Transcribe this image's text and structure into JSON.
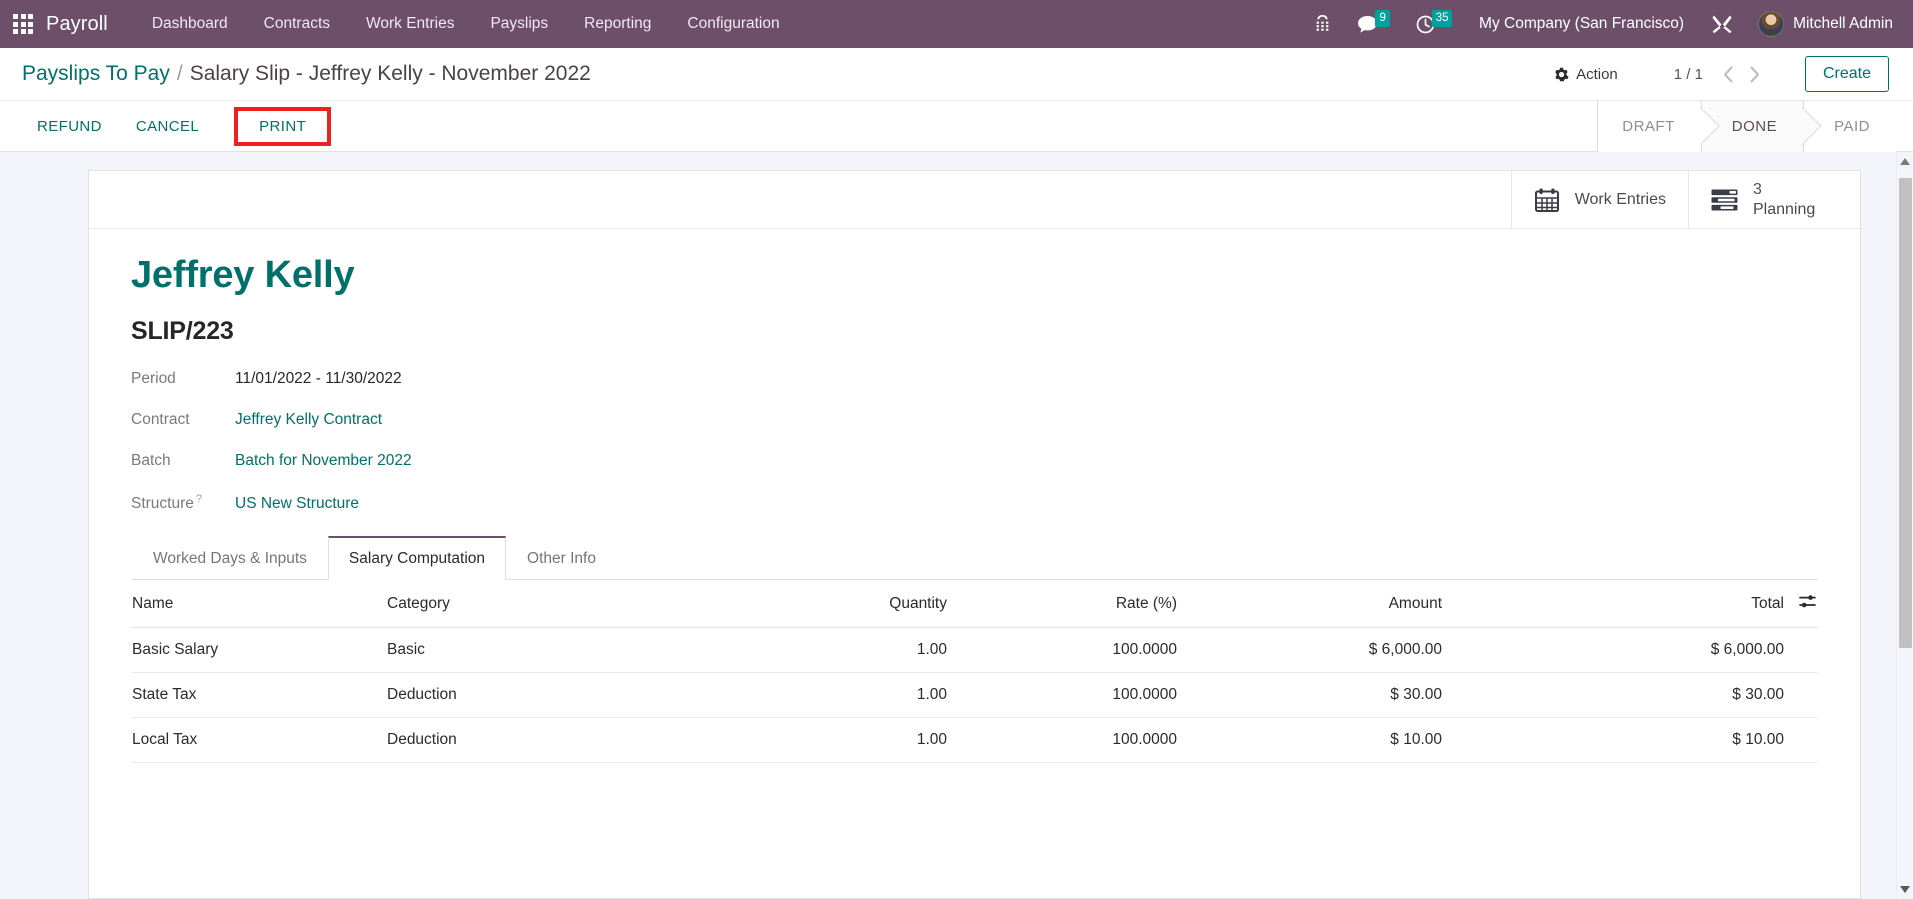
{
  "navbar": {
    "apps_icon": "apps-grid-icon",
    "brand": "Payroll",
    "menu_items": [
      {
        "label": "Dashboard"
      },
      {
        "label": "Contracts"
      },
      {
        "label": "Work Entries"
      },
      {
        "label": "Payslips"
      },
      {
        "label": "Reporting"
      },
      {
        "label": "Configuration"
      }
    ],
    "voip_icon": "phone-keypad-icon",
    "messages_icon": "chat-bubble-icon",
    "messages_count": "9",
    "activities_icon": "clock-icon",
    "activities_count": "35",
    "company": "My Company (San Francisco)",
    "tools_icon": "wrench-screwdriver-icon",
    "user_avatar": "user-avatar",
    "user_name": "Mitchell Admin",
    "badge_color": "#00a09d",
    "background_color": "#6d4f69"
  },
  "control_panel": {
    "breadcrumb": {
      "root": "Payslips To Pay",
      "separator": "/",
      "current": "Salary Slip - Jeffrey Kelly - November 2022"
    },
    "action_icon": "gear-icon",
    "action_label": "Action",
    "pager": {
      "value": "1 / 1",
      "prev_icon": "chevron-left-icon",
      "next_icon": "chevron-right-icon"
    },
    "create_label": "Create",
    "buttons": [
      {
        "label": "REFUND",
        "highlighted": false
      },
      {
        "label": "CANCEL",
        "highlighted": false
      },
      {
        "label": "PRINT",
        "highlighted": true
      }
    ],
    "highlight_color": "#f02020",
    "accent_color": "#00706b",
    "statusbar": [
      {
        "label": "DRAFT",
        "active": false
      },
      {
        "label": "DONE",
        "active": true
      },
      {
        "label": "PAID",
        "active": false
      }
    ]
  },
  "sheet": {
    "smart_buttons": [
      {
        "icon": "calendar-icon",
        "count": "",
        "label": "Work Entries"
      },
      {
        "icon": "tasks-list-icon",
        "count": "3",
        "label": "Planning"
      }
    ],
    "record_title": "Jeffrey Kelly",
    "record_reference": "SLIP/223",
    "fields": [
      {
        "label": "Period",
        "value": "11/01/2022 - 11/30/2022",
        "is_link": false,
        "tooltip": false
      },
      {
        "label": "Contract",
        "value": "Jeffrey Kelly Contract",
        "is_link": true,
        "tooltip": false
      },
      {
        "label": "Batch",
        "value": "Batch for November 2022",
        "is_link": true,
        "tooltip": false
      },
      {
        "label": "Structure",
        "value": "US New Structure",
        "is_link": true,
        "tooltip": true,
        "tooltip_mark": "?"
      }
    ],
    "tabs": [
      {
        "label": "Worked Days & Inputs",
        "active": false
      },
      {
        "label": "Salary Computation",
        "active": true
      },
      {
        "label": "Other Info",
        "active": false
      }
    ],
    "table": {
      "optional_columns_icon": "sliders-icon",
      "columns": [
        {
          "label": "Name",
          "align": "left"
        },
        {
          "label": "Category",
          "align": "left"
        },
        {
          "label": "Quantity",
          "align": "right"
        },
        {
          "label": "Rate (%)",
          "align": "right"
        },
        {
          "label": "Amount",
          "align": "right"
        },
        {
          "label": "Total",
          "align": "right"
        }
      ],
      "rows": [
        {
          "name": "Basic Salary",
          "category": "Basic",
          "quantity": "1.00",
          "rate": "100.0000",
          "amount": "$ 6,000.00",
          "total": "$ 6,000.00"
        },
        {
          "name": "State Tax",
          "category": "Deduction",
          "quantity": "1.00",
          "rate": "100.0000",
          "amount": "$ 30.00",
          "total": "$ 30.00"
        },
        {
          "name": "Local Tax",
          "category": "Deduction",
          "quantity": "1.00",
          "rate": "100.0000",
          "amount": "$ 10.00",
          "total": "$ 10.00"
        }
      ]
    }
  }
}
